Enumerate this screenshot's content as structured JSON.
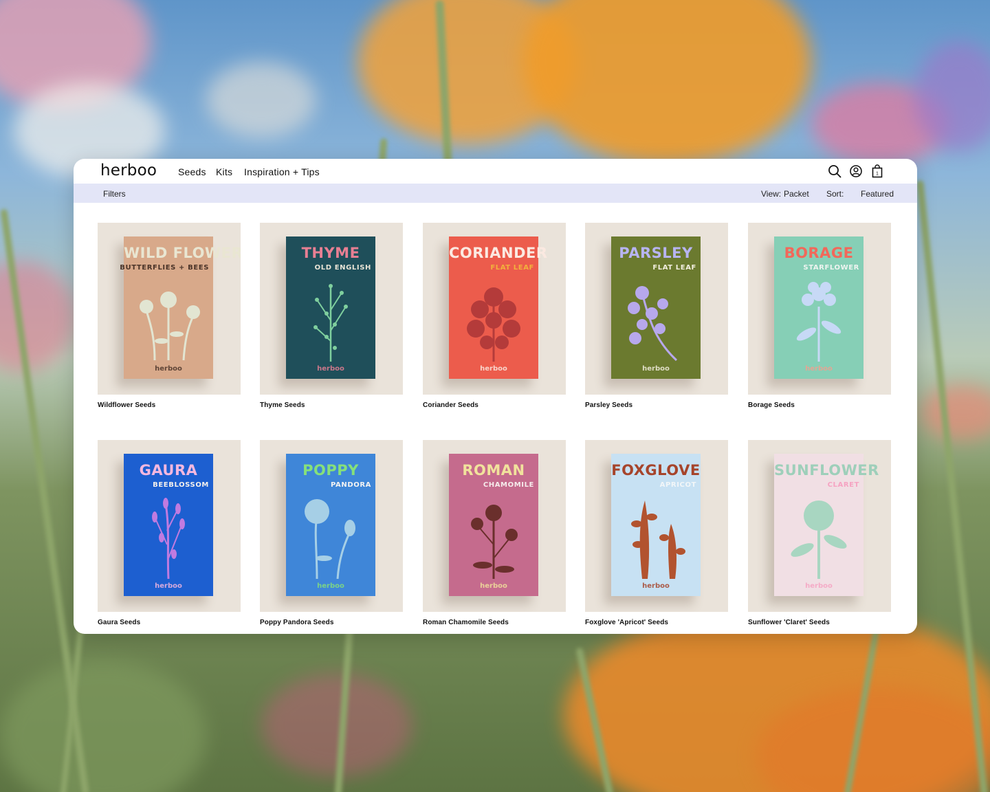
{
  "brand": {
    "logo": "herboo"
  },
  "nav": {
    "items": [
      "Seeds",
      "Kits",
      "Inspiration + Tips"
    ]
  },
  "icons": {
    "search": "search-icon",
    "account": "account-icon",
    "cart": "cart-icon"
  },
  "cart": {
    "count": "1"
  },
  "toolbar": {
    "filters_label": "Filters",
    "view_label": "View:",
    "view_value": "Packet",
    "sort_label": "Sort:",
    "sort_value": "Featured"
  },
  "colors": {
    "filterbar": "#e3e5f7",
    "tile": "#eae3da"
  },
  "products": [
    {
      "name": "Wildflower Seeds",
      "packet_title": "WILD FLOWER",
      "packet_sub": "BUTTERFLIES + BEES",
      "packet_brand": "herboo",
      "bg": "#d8a98a",
      "title_color": "#e9e6d2",
      "sub_color": "#4a3328",
      "plant_color": "#e2e5d2",
      "brand_color": "#4a3328"
    },
    {
      "name": "Thyme Seeds",
      "packet_title": "THYME",
      "packet_sub": "OLD ENGLISH",
      "packet_brand": "herboo",
      "bg": "#1f4f5a",
      "title_color": "#e87f93",
      "sub_color": "#e9e4d6",
      "plant_color": "#7fcf9e",
      "brand_color": "#e87f93"
    },
    {
      "name": "Coriander Seeds",
      "packet_title": "CORIANDER",
      "packet_sub": "FLAT LEAF",
      "packet_brand": "herboo",
      "bg": "#ec5c4c",
      "title_color": "#fbe9e1",
      "sub_color": "#f2b13c",
      "plant_color": "#b43b3a",
      "brand_color": "#fbe9e1"
    },
    {
      "name": "Parsley Seeds",
      "packet_title": "PARSLEY",
      "packet_sub": "FLAT LEAF",
      "packet_brand": "herboo",
      "bg": "#6b7a2f",
      "title_color": "#b7b4f2",
      "sub_color": "#f3efe0",
      "plant_color": "#b7a8ec",
      "brand_color": "#f3efe0"
    },
    {
      "name": "Borage Seeds",
      "packet_title": "BORAGE",
      "packet_sub": "STARFLOWER",
      "packet_brand": "herboo",
      "bg": "#86cfb6",
      "title_color": "#f2685a",
      "sub_color": "#eef4f0",
      "plant_color": "#c7d9f6",
      "brand_color": "#f2a090"
    },
    {
      "name": "Gaura Seeds",
      "packet_title": "GAURA",
      "packet_sub": "BEEBLOSSOM",
      "packet_brand": "herboo",
      "bg": "#1d5fd0",
      "title_color": "#f6b8df",
      "sub_color": "#f4f0ec",
      "plant_color": "#c07be0",
      "brand_color": "#f6b8df"
    },
    {
      "name": "Poppy Pandora Seeds",
      "packet_title": "POPPY",
      "packet_sub": "PANDORA",
      "packet_brand": "herboo",
      "bg": "#3f86d8",
      "title_color": "#86e07a",
      "sub_color": "#f3f3f3",
      "plant_color": "#a6cfe6",
      "brand_color": "#86e07a"
    },
    {
      "name": "Roman Chamomile Seeds",
      "packet_title": "ROMAN",
      "packet_sub": "CHAMOMILE",
      "packet_brand": "herboo",
      "bg": "#c56b8d",
      "title_color": "#f1e29c",
      "sub_color": "#f6ecec",
      "plant_color": "#6a2f2c",
      "brand_color": "#f1e29c"
    },
    {
      "name": "Foxglove 'Apricot' Seeds",
      "packet_title": "FOXGLOVE",
      "packet_sub": "APRICOT",
      "packet_brand": "herboo",
      "bg": "#c7e1f3",
      "title_color": "#a6442b",
      "sub_color": "#f2f6f8",
      "plant_color": "#b2532f",
      "brand_color": "#a6442b"
    },
    {
      "name": "Sunflower 'Claret' Seeds",
      "packet_title": "SUNFLOWER",
      "packet_sub": "CLARET",
      "packet_brand": "herboo",
      "bg": "#f1dfe4",
      "title_color": "#9ecfba",
      "sub_color": "#f6a3c2",
      "plant_color": "#a8d6c1",
      "brand_color": "#f6a3c2"
    }
  ]
}
